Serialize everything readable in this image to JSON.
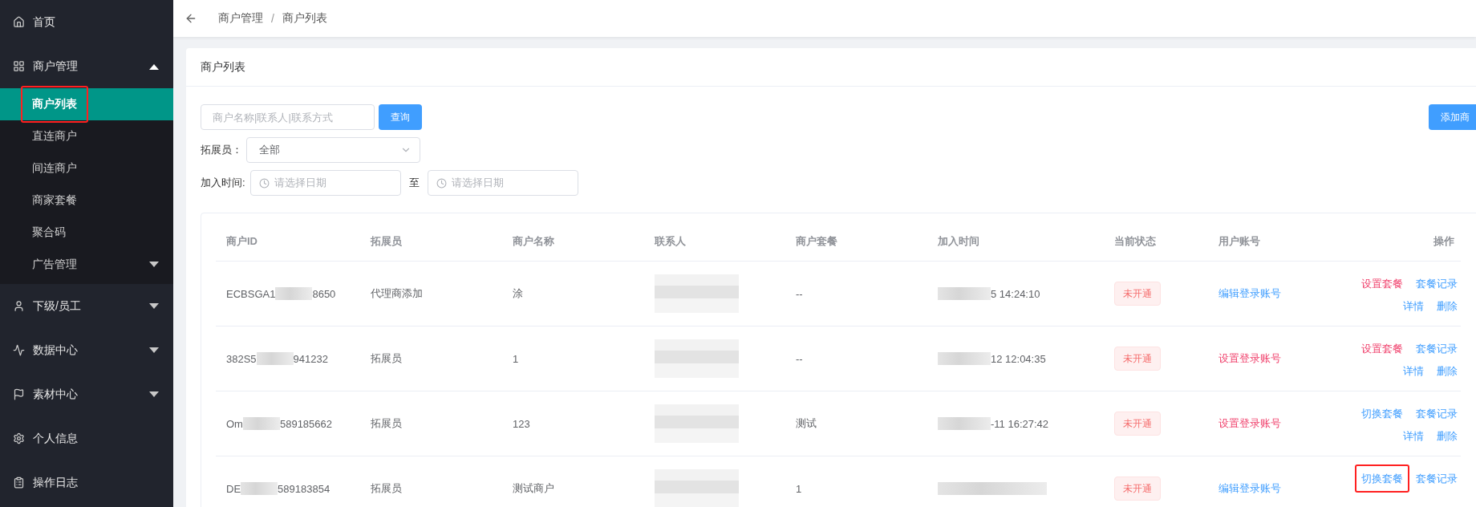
{
  "sidebar": {
    "items": [
      {
        "label": "首页"
      },
      {
        "label": "商户管理",
        "expanded": true,
        "children": [
          {
            "label": "商户列表",
            "selected": true,
            "highlighted": true
          },
          {
            "label": "直连商户",
            "selected": false,
            "highlighted": false
          },
          {
            "label": "间连商户",
            "selected": false,
            "highlighted": false
          },
          {
            "label": "商家套餐",
            "selected": false,
            "highlighted": false
          },
          {
            "label": "聚合码",
            "selected": false,
            "highlighted": false
          },
          {
            "label": "广告管理",
            "selected": false,
            "highlighted": false,
            "expanded": false
          }
        ]
      },
      {
        "label": "下级/员工",
        "expanded": false
      },
      {
        "label": "数据中心",
        "expanded": false
      },
      {
        "label": "素材中心",
        "expanded": false
      },
      {
        "label": "个人信息"
      },
      {
        "label": "操作日志"
      }
    ]
  },
  "breadcrumb": [
    "商户管理",
    "商户列表"
  ],
  "breadcrumb_separator": "/",
  "card": {
    "title": "商户列表",
    "search": {
      "placeholder": "商户名称|联系人|联系方式",
      "button": "查询"
    },
    "add_button": "添加商",
    "agent_filter": {
      "label": "拓展员：",
      "value": "全部"
    },
    "date_filter": {
      "label": "加入时间:",
      "separator": "至",
      "start_placeholder": "请选择日期",
      "end_placeholder": "请选择日期"
    }
  },
  "table": {
    "columns": [
      "商户ID",
      "拓展员",
      "商户名称",
      "联系人",
      "商户套餐",
      "加入时间",
      "当前状态",
      "用户账号",
      "操作"
    ],
    "rows": [
      {
        "id_start": "ECBSGA1",
        "id_end": "8650",
        "agent": "代理商添加",
        "name": "涂",
        "package": "--",
        "joined_end": "5 14:24:10",
        "status": "未开通",
        "account": {
          "label": "编辑登录账号",
          "color": "#409eff"
        },
        "action_lines": [
          [
            {
              "label": "设置套餐",
              "color": "#f0416c",
              "highlighted": false
            },
            {
              "label": "套餐记录",
              "color": "#409eff",
              "highlighted": false
            }
          ],
          [
            {
              "label": "详情",
              "color": "#409eff",
              "highlighted": false
            },
            {
              "label": "删除",
              "color": "#409eff",
              "highlighted": false
            }
          ]
        ]
      },
      {
        "id_start": "382S5",
        "id_end": "941232",
        "agent": "拓展员",
        "name": "1",
        "package": "--",
        "joined_end": "12 12:04:35",
        "status": "未开通",
        "account": {
          "label": "设置登录账号",
          "color": "#f0416c"
        },
        "action_lines": [
          [
            {
              "label": "设置套餐",
              "color": "#f0416c",
              "highlighted": false
            },
            {
              "label": "套餐记录",
              "color": "#409eff",
              "highlighted": false
            }
          ],
          [
            {
              "label": "详情",
              "color": "#409eff",
              "highlighted": false
            },
            {
              "label": "删除",
              "color": "#409eff",
              "highlighted": false
            }
          ]
        ]
      },
      {
        "id_start": "Om",
        "id_end": "589185662",
        "agent": "拓展员",
        "name": "123",
        "package": "测试",
        "joined_end": "-11 16:27:42",
        "status": "未开通",
        "account": {
          "label": "设置登录账号",
          "color": "#f0416c"
        },
        "action_lines": [
          [
            {
              "label": "切换套餐",
              "color": "#409eff",
              "highlighted": false
            },
            {
              "label": "套餐记录",
              "color": "#409eff",
              "highlighted": false
            }
          ],
          [
            {
              "label": "详情",
              "color": "#409eff",
              "highlighted": false
            },
            {
              "label": "删除",
              "color": "#409eff",
              "highlighted": false
            }
          ]
        ]
      },
      {
        "id_start": "DE",
        "id_end": "589183854",
        "agent": "拓展员",
        "name": "测试商户",
        "package": "1",
        "status": "未开通",
        "account": {
          "label": "编辑登录账号",
          "color": "#409eff"
        },
        "action_lines": [
          [
            {
              "label": "切换套餐",
              "color": "#409eff",
              "highlighted": true
            },
            {
              "label": "套餐记录",
              "color": "#409eff",
              "highlighted": false
            }
          ]
        ]
      }
    ]
  }
}
